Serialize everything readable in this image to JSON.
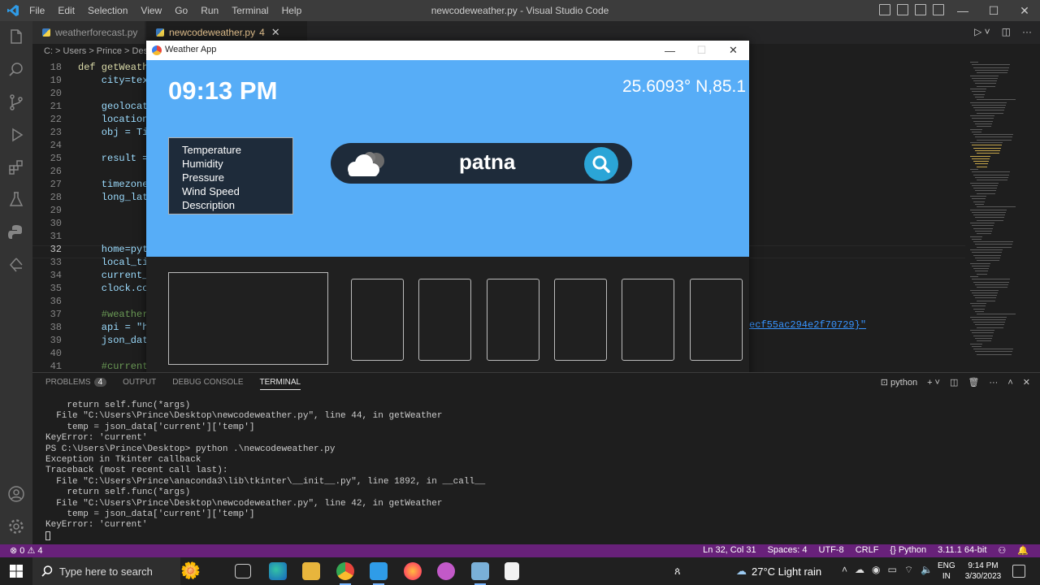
{
  "vscode": {
    "title": "newcodeweather.py - Visual Studio Code",
    "menu": [
      "File",
      "Edit",
      "Selection",
      "View",
      "Go",
      "Run",
      "Terminal",
      "Help"
    ],
    "tabs": [
      {
        "label": "weatherforecast.py"
      },
      {
        "label": "newcodeweather.py",
        "badge": "4"
      }
    ],
    "breadcrumb": "C: > Users > Prince > Desk",
    "code_lines": [
      {
        "n": "18",
        "code": "def getWeather"
      },
      {
        "n": "19",
        "code": "    city=text"
      },
      {
        "n": "20",
        "code": ""
      },
      {
        "n": "21",
        "code": "    geolocato"
      },
      {
        "n": "22",
        "code": "    location="
      },
      {
        "n": "23",
        "code": "    obj = Tim"
      },
      {
        "n": "24",
        "code": ""
      },
      {
        "n": "25",
        "code": "    result ="
      },
      {
        "n": "26",
        "code": ""
      },
      {
        "n": "27",
        "code": "    timezone."
      },
      {
        "n": "28",
        "code": "    long_lat."
      },
      {
        "n": "29",
        "code": ""
      },
      {
        "n": "30",
        "code": ""
      },
      {
        "n": "31",
        "code": ""
      },
      {
        "n": "32",
        "code": "    home=pytz"
      },
      {
        "n": "33",
        "code": "    local_tim"
      },
      {
        "n": "34",
        "code": "    current_t"
      },
      {
        "n": "35",
        "code": "    clock.con"
      },
      {
        "n": "36",
        "code": ""
      },
      {
        "n": "37",
        "code": "    #weather"
      },
      {
        "n": "38",
        "code": "    api = \"ht"
      },
      {
        "n": "39",
        "code": "    json_data"
      },
      {
        "n": "40",
        "code": ""
      },
      {
        "n": "41",
        "code": "    #current"
      }
    ],
    "api_key_tail": "ecf55ac294e2f70729}\"",
    "panel": {
      "tabs": [
        "PROBLEMS",
        "OUTPUT",
        "DEBUG CONSOLE",
        "TERMINAL"
      ],
      "problems_count": "4",
      "shell": "python"
    },
    "terminal_lines": [
      "    return self.func(*args)",
      "  File \"C:\\Users\\Prince\\Desktop\\newcodeweather.py\", line 44, in getWeather",
      "    temp = json_data['current']['temp']",
      "KeyError: 'current'",
      "PS C:\\Users\\Prince\\Desktop> python .\\newcodeweather.py",
      "Exception in Tkinter callback",
      "Traceback (most recent call last):",
      "  File \"C:\\Users\\Prince\\anaconda3\\lib\\tkinter\\__init__.py\", line 1892, in __call__",
      "    return self.func(*args)",
      "  File \"C:\\Users\\Prince\\Desktop\\newcodeweather.py\", line 42, in getWeather",
      "    temp = json_data['current']['temp']",
      "KeyError: 'current'"
    ],
    "status": {
      "left": "⊗ 0 ⚠ 4",
      "items": [
        "Ln 32, Col 31",
        "Spaces: 4",
        "UTF-8",
        "CRLF",
        "{} Python",
        "3.11.1 64-bit"
      ]
    }
  },
  "weather_app": {
    "window_title": "Weather App",
    "clock": "09:13 PM",
    "long_lat": "25.6093° N,85.1",
    "info_labels": [
      "Temperature",
      "Humidity",
      "Pressure",
      "Wind Speed",
      "Description"
    ],
    "search_value": "patna"
  },
  "taskbar": {
    "search_placeholder": "Type here to search",
    "weather": "27°C  Light rain",
    "lang": [
      "ENG",
      "IN"
    ],
    "time": "9:14 PM",
    "date": "3/30/2023"
  }
}
